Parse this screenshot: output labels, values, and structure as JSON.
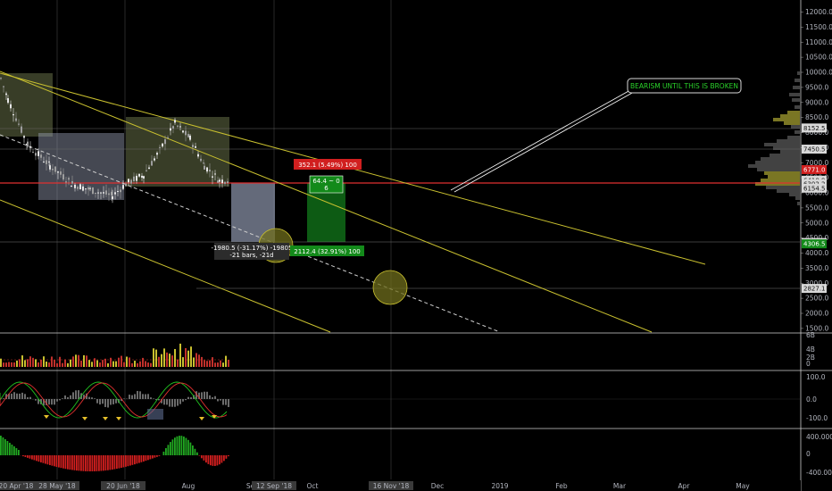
{
  "chart_data": {
    "type": "candlestick",
    "price_axis": {
      "ticks": [
        "12000.0",
        "11500.0",
        "11000.0",
        "10500.0",
        "10000.0",
        "9500.0",
        "9000.0",
        "8500.0",
        "8000.0",
        "7500.0",
        "7000.0",
        "6500.0",
        "6000.0",
        "5500.0",
        "5000.0",
        "4500.0",
        "4000.0",
        "3500.0",
        "3000.0",
        "2500.0",
        "2000.0",
        "1500.0"
      ],
      "range": [
        1400,
        12300
      ]
    },
    "time_axis": {
      "labels": [
        "20 Apr '18",
        "28 May '18",
        "20 Jun '18",
        "Aug",
        "Sep",
        "12 Sep '18",
        "Oct",
        "Nov",
        "16 Nov '18",
        "Dec",
        "2019",
        "Feb",
        "Mar",
        "Apr",
        "May"
      ],
      "highlighted": [
        "20 Apr '18",
        "28 May '18",
        "20 Jun '18",
        "12 Sep '18",
        "16 Nov '18"
      ]
    },
    "price_tags": [
      {
        "value": "8152.5",
        "price": 8152.5,
        "style": "gray"
      },
      {
        "value": "7450.5",
        "price": 7450.5,
        "style": "gray"
      },
      {
        "value": "6771.0",
        "price": 6771.0,
        "style": "red"
      },
      {
        "value": "6418.9",
        "price": 6418.9,
        "style": "gray"
      },
      {
        "value": "6302.2",
        "price": 6302.2,
        "style": "gray"
      },
      {
        "value": "6154.5",
        "price": 6154.5,
        "style": "gray"
      },
      {
        "value": "4352.0",
        "price": 4352.0,
        "style": "gray"
      },
      {
        "value": "4306.5",
        "price": 4306.5,
        "style": "green"
      },
      {
        "value": "2827.1",
        "price": 2827.1,
        "style": "gray"
      }
    ],
    "annotations": {
      "note": "BEARISM UNTIL THIS IS BROKEN",
      "short_target": "352.1 (5.49%) 100",
      "long_target": "2112.4 (32.91%) 100",
      "ratio_line1": "64.4 ~ 0",
      "ratio_line2": "6",
      "measure_line1": "-1980.5 (-31.17%) -19805",
      "measure_line2": "-21 bars, -21d"
    },
    "volume_pane": {
      "ticks": [
        "6B",
        "4B",
        "2B",
        "0"
      ]
    },
    "oscillator_pane": {
      "ticks": [
        "100.0",
        "0.0",
        "-100.0"
      ]
    },
    "histogram_pane": {
      "ticks": [
        "400.0000",
        "0",
        "-400.0000"
      ]
    },
    "colors": {
      "background": "#000000",
      "candle_up": "#9e9e9e",
      "candle_down": "#d6d6d6",
      "trendline": "#c9c02f",
      "horizontal_red": "#e03030",
      "up_green": "#21a821",
      "down_red": "#d11f1f"
    }
  }
}
